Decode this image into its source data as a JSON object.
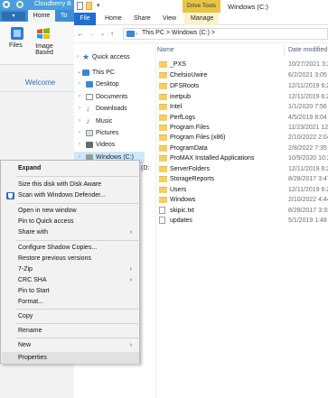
{
  "background_app": {
    "title": "Cloudberry B",
    "tabs": [
      "Home",
      "To"
    ],
    "ribbon": [
      {
        "label": "Files",
        "icon": "files-icon"
      },
      {
        "label": "Image\nBased",
        "icon": "windows-logo-icon"
      }
    ],
    "welcome": "Welcome"
  },
  "explorer": {
    "contextual_tab_group": "Drive Tools",
    "window_title": "Windows (C:)",
    "tabs": [
      "File",
      "Home",
      "Share",
      "View",
      "Manage"
    ],
    "address": {
      "segments": [
        "This PC",
        "Windows (C:)"
      ],
      "separator": ">"
    },
    "nav": [
      {
        "label": "Quick access",
        "icon": "star-icon",
        "color": "#2e7bd6",
        "level": 0
      },
      {
        "label": "This PC",
        "icon": "computer-icon",
        "color": "#3a87d8",
        "level": 0
      },
      {
        "label": "Desktop",
        "icon": "desktop-icon",
        "color": "#3a87d8",
        "level": 1
      },
      {
        "label": "Documents",
        "icon": "documents-icon",
        "color": "#8a8a8a",
        "level": 1
      },
      {
        "label": "Downloads",
        "icon": "downloads-icon",
        "color": "#2e7bd6",
        "level": 1
      },
      {
        "label": "Music",
        "icon": "music-icon",
        "color": "#3a87d8",
        "level": 1
      },
      {
        "label": "Pictures",
        "icon": "pictures-icon",
        "color": "#8a8a8a",
        "level": 1
      },
      {
        "label": "Videos",
        "icon": "videos-icon",
        "color": "#6a6a6a",
        "level": 1
      },
      {
        "label": "Windows (C:)",
        "icon": "drive-icon",
        "color": "#8a8a8a",
        "level": 1
      }
    ],
    "nav_partial": "(D:",
    "columns": {
      "name": "Name",
      "date": "Date modified"
    },
    "files": [
      {
        "name": "_PXS",
        "date": "10/27/2021 3:2",
        "kind": "folder"
      },
      {
        "name": "ChelsioUwire",
        "date": "6/2/2021 3:05",
        "kind": "folder"
      },
      {
        "name": "DFSRoots",
        "date": "12/11/2019 6:2",
        "kind": "folder"
      },
      {
        "name": "inetpub",
        "date": "12/11/2019 6:2",
        "kind": "folder"
      },
      {
        "name": "Intel",
        "date": "1/1/2020 7:56 F",
        "kind": "folder"
      },
      {
        "name": "PerfLogs",
        "date": "4/5/2019 8:04 /",
        "kind": "folder"
      },
      {
        "name": "Program Files",
        "date": "11/23/2021 12:",
        "kind": "folder"
      },
      {
        "name": "Program Files (x86)",
        "date": "2/10/2022 2:04",
        "kind": "folder"
      },
      {
        "name": "ProgramData",
        "date": "2/8/2022 7:35 /",
        "kind": "folder"
      },
      {
        "name": "ProMAX Installed Applications",
        "date": "10/9/2020 10:2",
        "kind": "folder"
      },
      {
        "name": "ServerFolders",
        "date": "12/11/2019 6:2",
        "kind": "folder"
      },
      {
        "name": "StorageReports",
        "date": "8/28/2017 3:47",
        "kind": "folder"
      },
      {
        "name": "Users",
        "date": "12/11/2019 6:2",
        "kind": "folder"
      },
      {
        "name": "Windows",
        "date": "2/10/2022 4:44",
        "kind": "folder"
      },
      {
        "name": "skipic.txt",
        "date": "8/28/2017 3:33",
        "kind": "file"
      },
      {
        "name": "updates",
        "date": "5/1/2019 1:48 F",
        "kind": "file"
      }
    ]
  },
  "context_menu": {
    "items": [
      {
        "label": "Expand",
        "bold": true
      },
      {
        "sep": true
      },
      {
        "label": "Size this disk with Disk Aware"
      },
      {
        "label": "Scan with Windows Defender...",
        "icon": "windows-defender-icon"
      },
      {
        "sep": true
      },
      {
        "label": "Open in new window"
      },
      {
        "label": "Pin to Quick access"
      },
      {
        "label": "Share with",
        "submenu": true
      },
      {
        "sep": true
      },
      {
        "label": "Configure Shadow Copies..."
      },
      {
        "label": "Restore previous versions"
      },
      {
        "label": "7-Zip",
        "submenu": true
      },
      {
        "label": "CRC SHA",
        "submenu": true
      },
      {
        "label": "Pin to Start"
      },
      {
        "label": "Format..."
      },
      {
        "sep": true
      },
      {
        "label": "Copy"
      },
      {
        "sep": true
      },
      {
        "label": "Rename"
      },
      {
        "sep": true
      },
      {
        "label": "New",
        "submenu": true
      },
      {
        "sep": true
      },
      {
        "label": "Properties",
        "hover": true
      }
    ]
  }
}
